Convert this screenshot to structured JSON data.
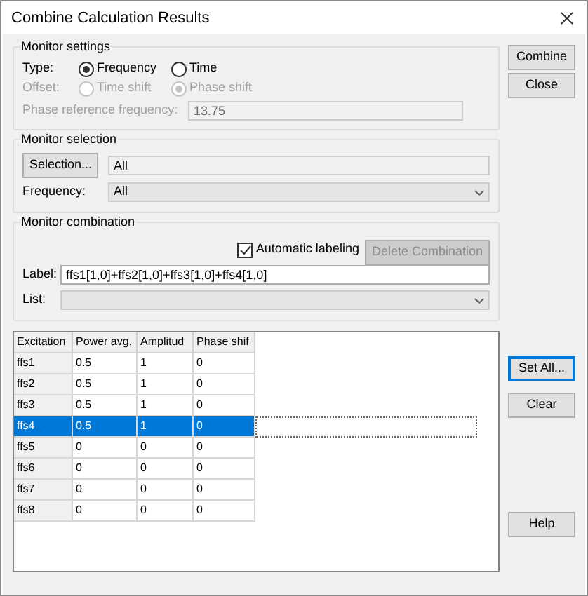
{
  "window": {
    "title": "Combine Calculation Results"
  },
  "top_buttons": [
    {
      "label": "Combine"
    },
    {
      "label": "Close"
    }
  ],
  "monitor_settings": {
    "title": "Monitor settings",
    "type_label": "Type:",
    "type_options": [
      {
        "label": "Frequency",
        "selected": true,
        "disabled": false
      },
      {
        "label": "Time",
        "selected": false,
        "disabled": false
      }
    ],
    "offset_label": "Offset:",
    "offset_disabled": true,
    "offset_options": [
      {
        "label": "Time shift",
        "selected": false,
        "disabled": true
      },
      {
        "label": "Phase shift",
        "selected": true,
        "disabled": true
      }
    ],
    "phase_reference_label": "Phase reference frequency:",
    "phase_reference_value": "13.75"
  },
  "monitor_selection": {
    "title": "Monitor selection",
    "selection_button": "Selection...",
    "selection_value": "All",
    "frequency_label": "Frequency:",
    "frequency_value": "All"
  },
  "monitor_combination": {
    "title": "Monitor combination",
    "automatic_labeling": {
      "label": "Automatic labeling",
      "checked": true
    },
    "delete_button": {
      "label": "Delete Combination",
      "disabled": true
    },
    "label_label": "Label:",
    "label_value": "ffs1[1,0]+ffs2[1,0]+ffs3[1,0]+ffs4[1,0]",
    "list_label": "List:"
  },
  "table": {
    "columns": [
      "Excitation",
      "Power avg.",
      "Amplitud",
      "Phase shif"
    ],
    "rows": [
      {
        "cells": [
          "ffs1",
          "0.5",
          "1",
          "0"
        ],
        "selected": false
      },
      {
        "cells": [
          "ffs2",
          "0.5",
          "1",
          "0"
        ],
        "selected": false
      },
      {
        "cells": [
          "ffs3",
          "0.5",
          "1",
          "0"
        ],
        "selected": false
      },
      {
        "cells": [
          "ffs4",
          "0.5",
          "1",
          "0"
        ],
        "selected": true
      },
      {
        "cells": [
          "ffs5",
          "0",
          "0",
          "0"
        ],
        "selected": false
      },
      {
        "cells": [
          "ffs6",
          "0",
          "0",
          "0"
        ],
        "selected": false
      },
      {
        "cells": [
          "ffs7",
          "0",
          "0",
          "0"
        ],
        "selected": false
      },
      {
        "cells": [
          "ffs8",
          "0",
          "0",
          "0"
        ],
        "selected": false
      }
    ]
  },
  "side_buttons": [
    {
      "label": "Set All...",
      "default": true
    },
    {
      "label": "Clear",
      "default": false
    }
  ],
  "help_button": {
    "label": "Help"
  }
}
